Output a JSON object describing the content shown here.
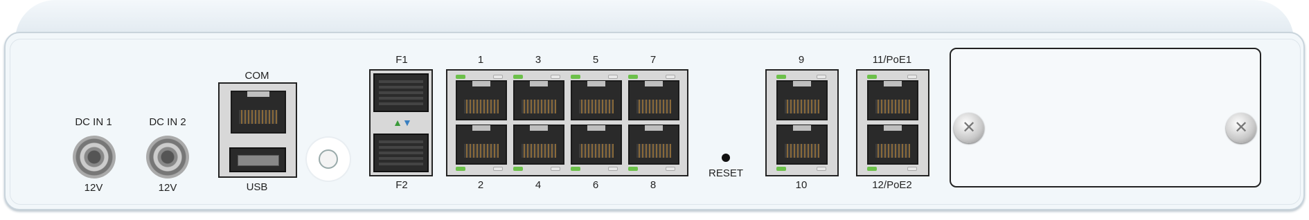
{
  "device_panel": {
    "dc_in_1": {
      "label": "DC IN 1",
      "voltage": "12V"
    },
    "dc_in_2": {
      "label": "DC IN 2",
      "voltage": "12V"
    },
    "com": {
      "label": "COM"
    },
    "usb": {
      "label": "USB"
    },
    "sfp": {
      "top_label": "F1",
      "bottom_label": "F2"
    },
    "ports_group1": {
      "top_labels": [
        "1",
        "3",
        "5",
        "7"
      ],
      "bottom_labels": [
        "2",
        "4",
        "6",
        "8"
      ]
    },
    "reset": {
      "label": "RESET"
    },
    "ports_group2": {
      "top_label": "9",
      "bottom_label": "10"
    },
    "ports_group3": {
      "top_label": "11/PoE1",
      "bottom_label": "12/PoE2"
    },
    "icons": {
      "power": "power-button-icon",
      "screw": "screw-icon",
      "sfp_arrows": "sfp-arrow-icons"
    },
    "colors": {
      "link_led": "#6cc04a",
      "activity_led": "#e8e8e8",
      "chassis": "#f2f7fa"
    }
  }
}
